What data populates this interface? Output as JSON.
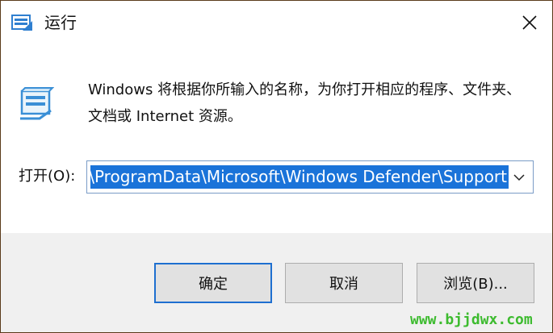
{
  "window": {
    "title": "运行",
    "close_icon": "close-icon"
  },
  "dialog": {
    "description": "Windows 将根据你所输入的名称，为你打开相应的程序、文件夹、文档或 Internet 资源。",
    "open_label": "打开(O):",
    "open_value": "C:\\ProgramData\\Microsoft\\Windows Defender\\Support",
    "selection_color": "#1a73d9"
  },
  "buttons": {
    "ok": "确定",
    "cancel": "取消",
    "browse": "浏览(B)..."
  },
  "watermark": "www.bjjdwx.com"
}
